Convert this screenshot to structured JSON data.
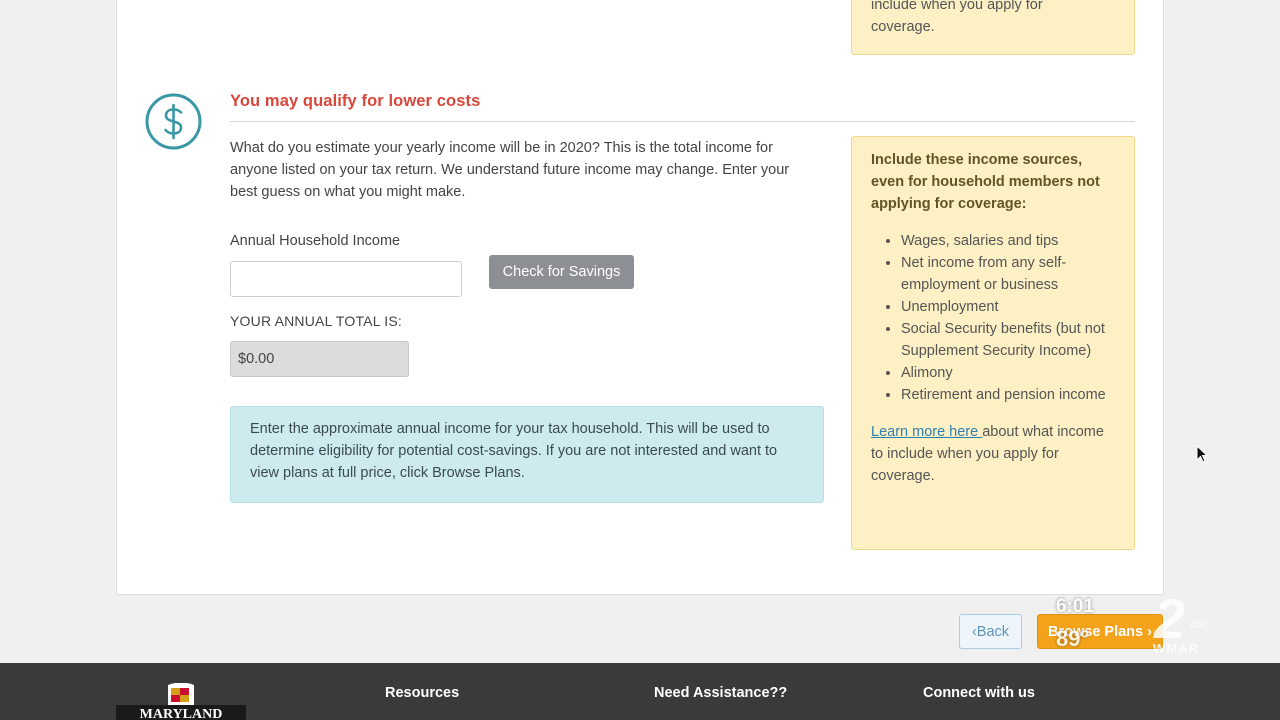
{
  "top_note": {
    "lines": [
      "include when you apply for",
      "coverage."
    ]
  },
  "section": {
    "icon": "dollar-circle-icon",
    "title": "You may qualify for lower costs",
    "intro": "What do you estimate your yearly income will be in 2020? This is the total income for anyone listed on your tax return. We understand future income may change. Enter your best guess on what you might make."
  },
  "form": {
    "income_label": "Annual Household Income",
    "income_value": "",
    "check_button": "Check for Savings",
    "total_label": "YOUR ANNUAL TOTAL IS:",
    "total_value": "$0.00"
  },
  "info_box": {
    "text": "Enter the approximate annual income for your tax household. This will be used to determine eligibility for potential cost-savings. If you are not interested and want to view plans at full price, click Browse Plans."
  },
  "side_note": {
    "heading": "Include these income sources, even for household members not applying for coverage:",
    "items": [
      "Wages, salaries and tips",
      "Net income from any self-employment or business",
      "Unemployment",
      "Social Security benefits (but not Supplement Security Income)",
      "Alimony",
      "Retirement and pension income"
    ],
    "link_text": "Learn more here ",
    "after_link": "about what income to include when you apply for coverage."
  },
  "nav": {
    "back": "‹Back",
    "browse": "Browse Plans ›"
  },
  "footer": {
    "col1": "Resources",
    "col2": "Need Assistance??",
    "col3": "Connect with us",
    "logo_text": "MARYLAND"
  },
  "tv_bug": {
    "time": "6:01",
    "temp": "89°",
    "channel": "2",
    "network": "abc",
    "callsign": "WMAR"
  },
  "colors": {
    "accent_red": "#d9473b",
    "icon_teal": "#3a97a5",
    "browse_orange": "#f3a21a",
    "info_blue": "#cdebef",
    "note_yellow": "#fdf0c4"
  }
}
